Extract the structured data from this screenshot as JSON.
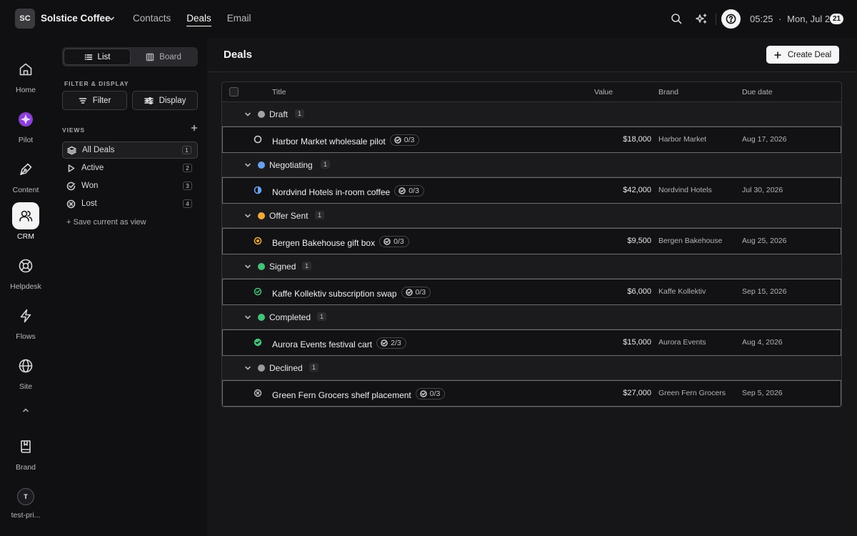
{
  "topbar": {
    "org_initials": "SC",
    "org_name": "Solstice Coffee",
    "nav": [
      {
        "label": "Contacts",
        "active": false
      },
      {
        "label": "Deals",
        "active": true
      },
      {
        "label": "Email",
        "active": false
      }
    ],
    "clock_time": "05:25",
    "clock_sep": "·",
    "clock_date": "Mon, Jul 20",
    "notification_count": "21"
  },
  "rail": {
    "items": [
      {
        "label": "Home",
        "icon": "home-icon"
      },
      {
        "label": "Pilot",
        "icon": "pilot-icon"
      },
      {
        "label": "Content",
        "icon": "pen-icon"
      },
      {
        "label": "CRM",
        "icon": "users-icon",
        "active": true
      },
      {
        "label": "Helpdesk",
        "icon": "lifebuoy-icon"
      },
      {
        "label": "Flows",
        "icon": "bolt-icon"
      },
      {
        "label": "Site",
        "icon": "globe-icon"
      }
    ],
    "brand_label": "Brand",
    "user_initial": "T",
    "user_label": "test-pri..."
  },
  "panel": {
    "segment": {
      "list": "List",
      "board": "Board"
    },
    "filter_section": "FILTER & DISPLAY",
    "filter_label": "Filter",
    "display_label": "Display",
    "views_section": "VIEWS",
    "views": [
      {
        "label": "All Deals",
        "count": "1",
        "icon": "layers-icon",
        "active": true
      },
      {
        "label": "Active",
        "count": "2",
        "icon": "play-icon"
      },
      {
        "label": "Won",
        "count": "3",
        "icon": "check-circle-icon"
      },
      {
        "label": "Lost",
        "count": "4",
        "icon": "x-circle-icon"
      }
    ],
    "save_view": "+ Save current as view"
  },
  "main": {
    "title": "Deals",
    "create_label": "Create Deal",
    "columns": {
      "title": "Title",
      "value": "Value",
      "brand": "Brand",
      "due": "Due date"
    },
    "groups": [
      {
        "name": "Draft",
        "count": "1",
        "color": "#a1a1a6",
        "deal": {
          "title": "Harbor Market wholesale pilot",
          "tasks": "0/3",
          "value": "$18,000",
          "brand": "Harbor Market",
          "due": "Aug 17, 2026",
          "status_icon": "circle-empty-icon"
        }
      },
      {
        "name": "Negotiating",
        "count": "1",
        "color": "#6aa0ea",
        "deal": {
          "title": "Nordvind Hotels in-room coffee",
          "tasks": "0/3",
          "value": "$42,000",
          "brand": "Nordvind Hotels",
          "due": "Jul 30, 2026",
          "status_icon": "circle-half-icon"
        }
      },
      {
        "name": "Offer Sent",
        "count": "1",
        "color": "#f0aa3a",
        "deal": {
          "title": "Bergen Bakehouse gift box",
          "tasks": "0/3",
          "value": "$9,500",
          "brand": "Bergen Bakehouse",
          "due": "Aug 25, 2026",
          "status_icon": "circle-dot-icon"
        }
      },
      {
        "name": "Signed",
        "count": "1",
        "color": "#44c27a",
        "deal": {
          "title": "Kaffe Kollektiv subscription swap",
          "tasks": "0/3",
          "value": "$6,000",
          "brand": "Kaffe Kollektiv",
          "due": "Sep 15, 2026",
          "status_icon": "circle-check-outline-icon"
        }
      },
      {
        "name": "Completed",
        "count": "1",
        "color": "#44c27a",
        "deal": {
          "title": "Aurora Events festival cart",
          "tasks": "2/3",
          "value": "$15,000",
          "brand": "Aurora Events",
          "due": "Aug 4, 2026",
          "status_icon": "circle-check-filled-icon"
        }
      },
      {
        "name": "Declined",
        "count": "1",
        "color": "#9a9aa0",
        "deal": {
          "title": "Green Fern Grocers shelf placement",
          "tasks": "0/3",
          "value": "$27,000",
          "brand": "Green Fern Grocers",
          "due": "Sep 5, 2026",
          "status_icon": "circle-x-icon"
        }
      }
    ]
  }
}
